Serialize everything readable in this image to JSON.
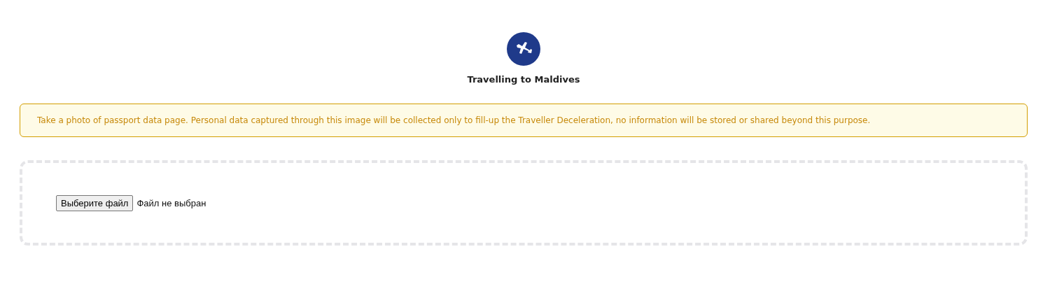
{
  "header": {
    "title": "Travelling to Maldives"
  },
  "notice": {
    "text": "Take a photo of passport data page. Personal data captured through this image will be collected only to fill-up the Traveller Deceleration, no information will be stored or shared beyond this purpose."
  },
  "upload": {
    "button": "Выберите файл",
    "status": "Файл не выбран"
  }
}
